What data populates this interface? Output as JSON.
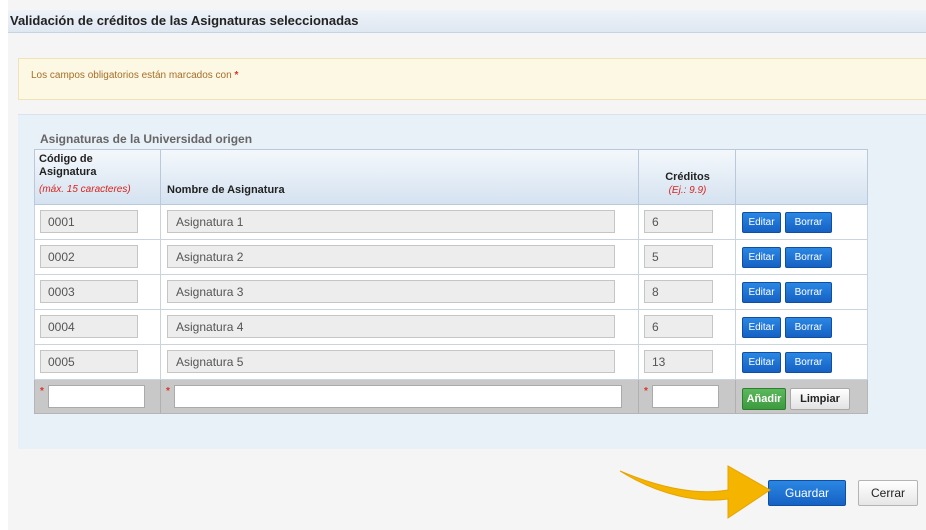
{
  "page_title": "Validación de créditos de las Asignaturas seleccionadas",
  "notice": {
    "text": "Los campos obligatorios están marcados con ",
    "required_mark": "*"
  },
  "section_label": "Asignaturas de la Universidad origen",
  "columns": {
    "code_label": "Código de Asignatura",
    "code_hint": "(máx. 15 caracteres)",
    "name_label": "Nombre de Asignatura",
    "credits_label": "Créditos",
    "credits_hint": "(Ej.: 9.9)"
  },
  "rows": [
    {
      "code": "0001",
      "name": "Asignatura 1",
      "credits": "6",
      "edit": "Editar",
      "delete": "Borrar"
    },
    {
      "code": "0002",
      "name": "Asignatura 2",
      "credits": "5",
      "edit": "Editar",
      "delete": "Borrar"
    },
    {
      "code": "0003",
      "name": "Asignatura 3",
      "credits": "8",
      "edit": "Editar",
      "delete": "Borrar"
    },
    {
      "code": "0004",
      "name": "Asignatura 4",
      "credits": "6",
      "edit": "Editar",
      "delete": "Borrar"
    },
    {
      "code": "0005",
      "name": "Asignatura 5",
      "credits": "13",
      "edit": "Editar",
      "delete": "Borrar"
    }
  ],
  "new_row": {
    "required_mark": "*",
    "add_label": "Añadir",
    "clear_label": "Limpiar",
    "code_value": "",
    "name_value": "",
    "credits_value": ""
  },
  "footer": {
    "save_label": "Guardar",
    "close_label": "Cerrar"
  },
  "icons": {
    "highlight_arrow": "arrow-right-icon"
  },
  "colors": {
    "primary_button": "#1a6fd4",
    "add_button": "#4cae4c",
    "arrow": "#f5b400",
    "required": "#e0302a"
  }
}
